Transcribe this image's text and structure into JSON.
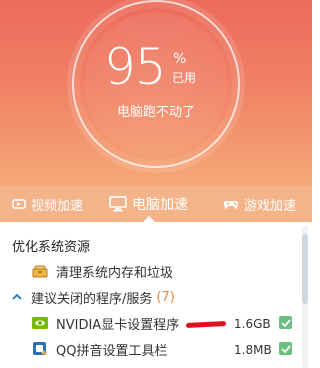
{
  "header": {
    "percent_value": "95",
    "percent_sign": "%",
    "used_label": "已用",
    "status_text": "电脑跑不动了"
  },
  "tabs": [
    {
      "label": "视频加速",
      "icon": "video-icon"
    },
    {
      "label": "电脑加速",
      "icon": "monitor-icon",
      "active": true
    },
    {
      "label": "游戏加速",
      "icon": "gamepad-icon"
    }
  ],
  "section": {
    "title": "优化系统资源",
    "clean_label": "清理系统内存和垃圾",
    "group_label": "建议关闭的程序/服务",
    "group_count": "(7)"
  },
  "items": [
    {
      "name": "NVIDIA显卡设置程序",
      "size": "1.6GB",
      "checked": true,
      "icon": "nvidia-icon"
    },
    {
      "name": "QQ拼音设置工具栏",
      "size": "1.8MB",
      "checked": true,
      "icon": "qq-pinyin-icon"
    }
  ],
  "colors": {
    "hero_top": "#ec6b5c",
    "hero_bottom": "#f6a978",
    "tab_bar": "#f3b48a",
    "check": "#6cbf7e",
    "accent_count": "#e98a3b"
  }
}
